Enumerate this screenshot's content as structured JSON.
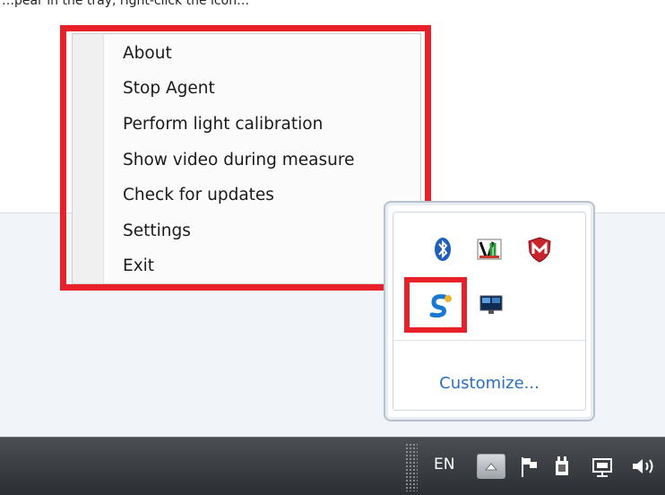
{
  "top_partial_text": "…pear in the tray, right-click the icon…",
  "context_menu": {
    "items": [
      {
        "label": "About"
      },
      {
        "label": "Stop Agent"
      },
      {
        "label": "Perform light calibration"
      },
      {
        "label": "Show video during measure"
      },
      {
        "label": "Check for updates"
      },
      {
        "label": "Settings"
      },
      {
        "label": "Exit"
      }
    ]
  },
  "tray_popup": {
    "customize_label": "Customize...",
    "icons": [
      "bluetooth-icon",
      "vmware-icon",
      "mcafee-icon",
      "agent-app-icon",
      "display-monitor-icon"
    ]
  },
  "taskbar": {
    "language": "EN",
    "icons": [
      "show-hidden-icons-button",
      "action-center-flag-icon",
      "power-plug-icon",
      "network-icon",
      "volume-icon"
    ]
  },
  "colors": {
    "highlight_red": "#e8202a",
    "link_blue": "#2a6fc0",
    "taskbar_dark": "#3a3d41"
  }
}
